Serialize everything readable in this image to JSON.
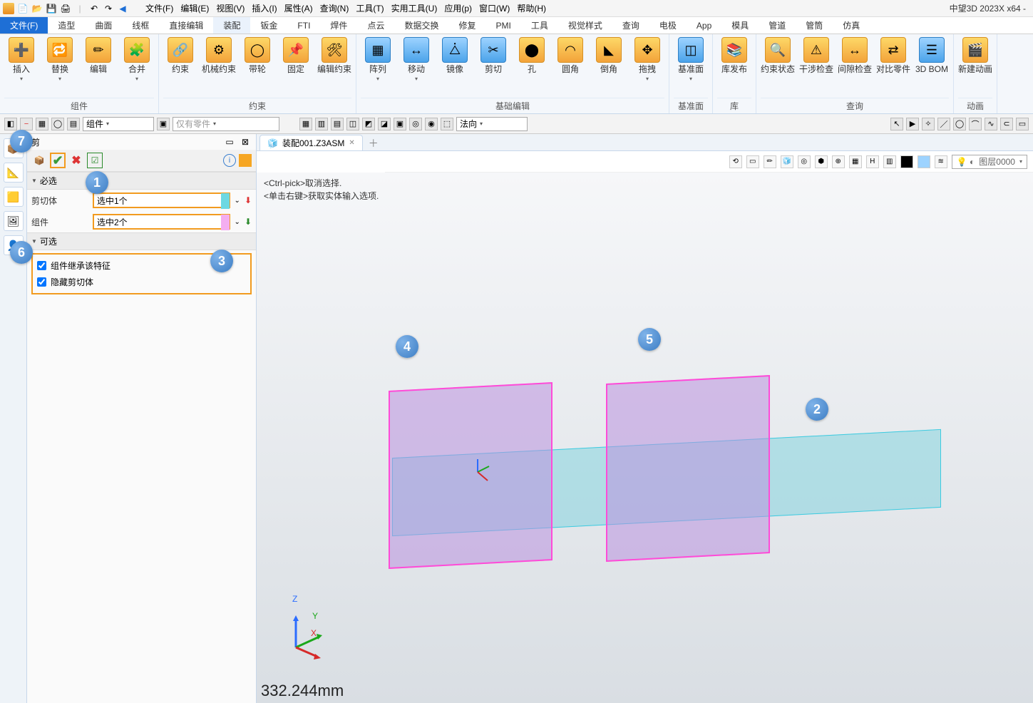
{
  "app_title": "中望3D 2023X x64 -",
  "menus": [
    "文件(F)",
    "编辑(E)",
    "视图(V)",
    "插入(I)",
    "属性(A)",
    "查询(N)",
    "工具(T)",
    "实用工具(U)",
    "应用(p)",
    "窗口(W)",
    "帮助(H)"
  ],
  "ribbon_tabs": [
    "文件(F)",
    "造型",
    "曲面",
    "线框",
    "直接编辑",
    "装配",
    "钣金",
    "FTI",
    "焊件",
    "点云",
    "数据交换",
    "修复",
    "PMI",
    "工具",
    "视觉样式",
    "查询",
    "电极",
    "App",
    "模具",
    "管道",
    "管筒",
    "仿真"
  ],
  "ribbon_active_index": 5,
  "ribbon_groups": [
    {
      "name": "组件",
      "btns": [
        "插入",
        "替换",
        "编辑",
        "合并"
      ]
    },
    {
      "name": "约束",
      "btns": [
        "约束",
        "机械约束",
        "带轮",
        "固定",
        "编辑约束"
      ]
    },
    {
      "name": "基础编辑",
      "btns": [
        "阵列",
        "移动",
        "镜像",
        "剪切",
        "孔",
        "圆角",
        "倒角",
        "拖拽"
      ]
    },
    {
      "name": "基准面",
      "btns": [
        "基准面"
      ]
    },
    {
      "name": "库",
      "btns": [
        "库发布"
      ]
    },
    {
      "name": "查询",
      "btns": [
        "约束状态",
        "干涉检查",
        "间隙检查",
        "对比零件",
        "3D BOM"
      ]
    },
    {
      "name": "动画",
      "btns": [
        "新建动画"
      ]
    }
  ],
  "toolbar2": {
    "mode_combo": "组件",
    "filter_combo": "仅有零件",
    "direction_combo": "法向"
  },
  "panel": {
    "title_short": "剪",
    "sect_required": "必选",
    "sect_optional": "可选",
    "rows": {
      "cutbody_label": "剪切体",
      "cutbody_value": "选中1个",
      "component_label": "组件",
      "component_value": "选中2个"
    },
    "options": {
      "inherit": "组件继承该特征",
      "hide": "隐藏剪切体"
    }
  },
  "doc_tab": "装配001.Z3ASM",
  "layer_combo": "图层0000",
  "hint_line1": "<Ctrl-pick>取消选择.",
  "hint_line2": "<单击右键>获取实体输入选项.",
  "measurement": "332.244mm",
  "axis": {
    "z": "Z",
    "y": "Y",
    "x": "X"
  },
  "callouts": [
    "1",
    "2",
    "3",
    "4",
    "5",
    "6",
    "7"
  ]
}
